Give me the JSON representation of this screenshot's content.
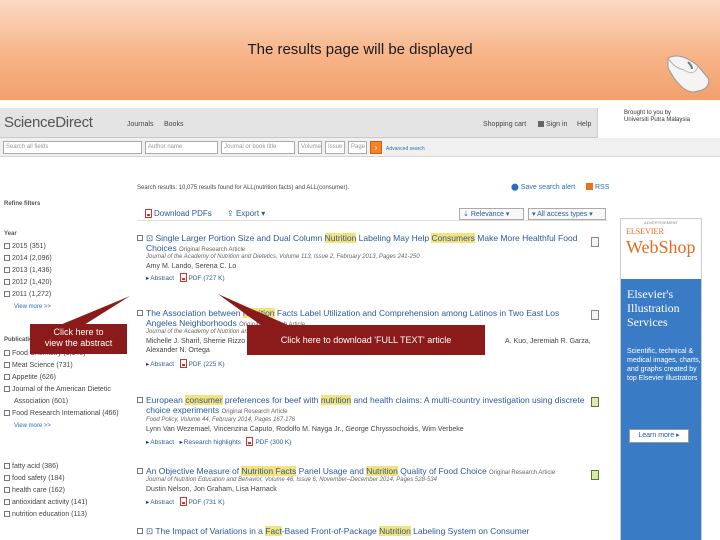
{
  "slide": {
    "title": "The results page will be displayed"
  },
  "header": {
    "brand": "ScienceDirect",
    "nav": [
      "Journals",
      "Books"
    ],
    "right_links": [
      "Shopping cart",
      "Sign in",
      "Help"
    ],
    "brought_by_line1": "Brought to you by",
    "brought_by_line2": "Universiti Putra Malaysia"
  },
  "search": {
    "placeholders": [
      "Search all fields",
      "Author name",
      "Journal or book title",
      "Volume",
      "Issue",
      "Page"
    ],
    "go_label": "›",
    "advanced_label": "Advanced search"
  },
  "filters": {
    "title": "Refine filters",
    "year_title": "Year",
    "years": [
      "2015 (351)",
      "2014 (2,096)",
      "2013 (1,436)",
      "2012 (1,420)",
      "2011 (1,272)"
    ],
    "year_view_more": "View more >>",
    "pub_title": "Publication title",
    "pubs_partial": [
      "Food Chemistry (1,146)",
      "Meat Science (731)",
      "Appetite (626)",
      "Journal of the American Dietetic",
      "Association (601)",
      "Food Research International (466)"
    ],
    "pub_view_more": "View more >>",
    "topics": [
      "fatty acid (386)",
      "food safety (184)",
      "health care (162)",
      "antioxidant activity (141)",
      "nutrition education (113)"
    ]
  },
  "results": {
    "summary": "Search results: 10,075 results found for ALL(nutrition facts) and ALL(consumer).",
    "save_alert": "Save search alert",
    "rss": "RSS",
    "download_pdfs": "Download PDFs",
    "export": "Export",
    "sort": "Relevance",
    "access": "All access types",
    "items": [
      {
        "title_pre": "Single Larger Portion Size and Dual Column ",
        "kw1": "Nutrition",
        "title_mid": " Labeling May Help ",
        "kw2": "Consumers",
        "title_post": " Make More Healthful Food Choices",
        "type": "Original Research Article",
        "journal": "Journal of the Academy of Nutrition and Dietetics, Volume 113, Issue 2, February 2013, Pages 241-250",
        "authors": "Amy M. Lando, Serena C. Lo",
        "actions": [
          "Abstract",
          "PDF (727 K)"
        ]
      },
      {
        "title_pre": "The Association between ",
        "kw1": "Nutrition",
        "title_mid": " Facts Label Utilization and Comprehension among Latinos in Two East Los Angeles Neighborhoods",
        "kw2": "",
        "title_post": "",
        "type": "Original Research Article",
        "journal": "Journal of the Academy of Nutrition and Dietetics, Volume",
        "authors": "Michelle J. Sharif, Sherrie Rizzo",
        "authors_right": "A. Kuo, Jeremiah R. Garza,",
        "authors2": "Alexander N. Ortega",
        "actions": [
          "Abstract",
          "PDF (225 K)"
        ]
      },
      {
        "title_pre": "European ",
        "kw1": "consumer",
        "title_mid": " preferences for beef with ",
        "kw2": "nutrition",
        "title_post": " and health claims: A multi-country investigation using discrete choice experiments",
        "type": "Original Research Article",
        "journal": "Food Policy, Volume 44, February 2014, Pages 167-176",
        "authors": "Lynn Van Wezemael, Vincenzina Caputo, Rodolfo M. Nayga Jr., George Chryssochoidis, Wim Verbeke",
        "actions": [
          "Abstract",
          "Research highlights",
          "PDF (300 K)"
        ]
      },
      {
        "title_pre": "An Objective Measure of ",
        "kw1": "Nutrition Facts",
        "title_mid": " Panel Usage and ",
        "kw2": "Nutrition",
        "title_post": " Quality of Food Choice",
        "type": "Original Research Article",
        "journal": "Journal of Nutrition Education and Behavior, Volume 46, Issue 6, November–December 2014, Pages 528-534",
        "authors": "Dustin Nelson, Jon Graham, Lisa Harnack",
        "actions": [
          "Abstract",
          "PDF (731 K)"
        ]
      },
      {
        "title_pre": "The Impact of Variations in a ",
        "kw1": "Fact",
        "title_mid": "-Based Front-of-Package ",
        "kw2": "Nutrition",
        "title_post": " Labeling System on Consumer",
        "type": "",
        "journal": "",
        "authors": "",
        "actions": []
      }
    ]
  },
  "ad": {
    "label": "ADVERTISEMENT",
    "brand": "ELSEVIER",
    "product": "WebShop",
    "headline": "Elsevier's Illustration Services",
    "body": "Scientific, technical & medical images, charts, and graphs created by top Elsevier illustrators",
    "cta": "Learn more ▸"
  },
  "callouts": {
    "abstract_line1": "Click  here to",
    "abstract_line2": "view the abstract",
    "fulltext": "Click here to download 'FULL TEXT' article"
  }
}
